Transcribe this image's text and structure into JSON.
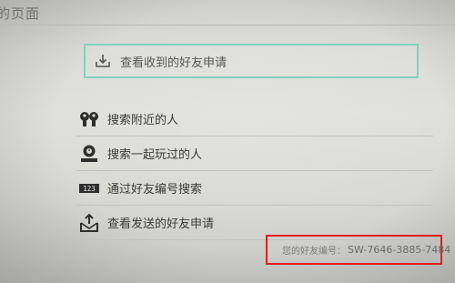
{
  "page": {
    "title": "的页面"
  },
  "received_requests": {
    "label": "查看收到的好友申请",
    "icon": "download-tray-icon"
  },
  "menu": {
    "items": [
      {
        "label": "搜索附近的人",
        "icon": "people-nearby-icon"
      },
      {
        "label": "搜索一起玩过的人",
        "icon": "played-with-icon"
      },
      {
        "label": "通过好友编号搜索",
        "icon": "number-123-icon"
      },
      {
        "label": "查看发送的好友申请",
        "icon": "upload-tray-icon"
      }
    ]
  },
  "friend_code": {
    "label": "您的好友编号：",
    "value": "SW-7646-3885-7484"
  },
  "colors": {
    "highlight_border": "#7fd3bf",
    "annotation_box": "#e02020"
  }
}
